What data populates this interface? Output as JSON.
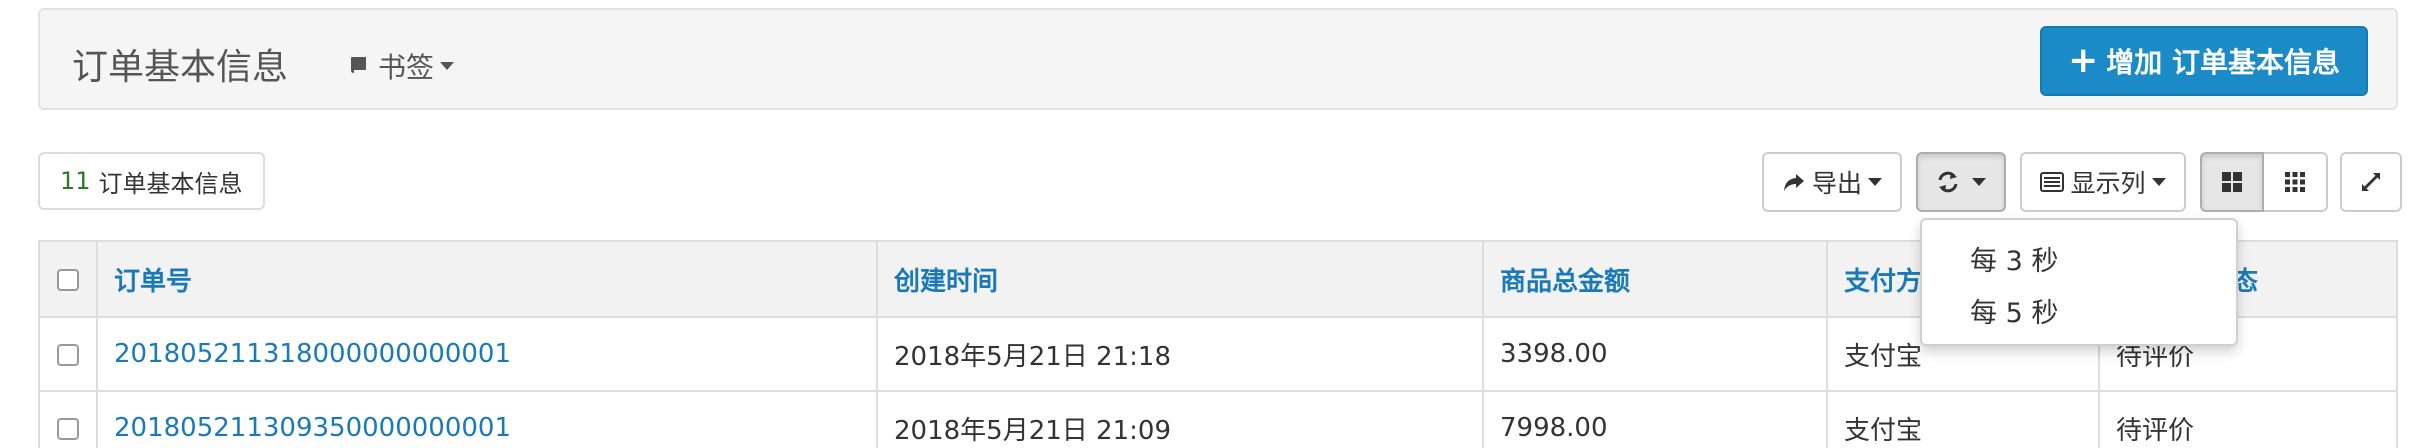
{
  "header": {
    "title": "订单基本信息",
    "bookmark_label": "书签",
    "add_button_label": "增加 订单基本信息"
  },
  "toolbar": {
    "count": "11",
    "count_label": "订单基本信息",
    "export_label": "导出",
    "columns_label": "显示列"
  },
  "refresh_menu": {
    "items": [
      "每 3 秒",
      "每 5 秒"
    ]
  },
  "table": {
    "columns": [
      "订单号",
      "创建时间",
      "商品总金额",
      "支付方式",
      "状态"
    ],
    "visible_header_fragments": [
      "支付方",
      "态"
    ],
    "rows": [
      {
        "order_no": "201805211318000000000001",
        "created": "2018年5月21日 21:18",
        "amount": "3398.00",
        "payment": "支付宝",
        "status": "待评价"
      },
      {
        "order_no": "201805211309350000000001",
        "created": "2018年5月21日 21:09",
        "amount": "7998.00",
        "payment": "支付宝",
        "status": "待评价"
      }
    ]
  },
  "colors": {
    "primary": "#1a8bc7",
    "link": "#1a7ab8",
    "count": "#2a7a2a"
  },
  "icons": {
    "bookmark": "book-icon",
    "add": "plus-icon",
    "export": "share-icon",
    "refresh": "refresh-icon",
    "columns": "list-icon",
    "card_view": "th-large-icon",
    "grid_view": "th-icon",
    "fullscreen": "expand-icon"
  }
}
